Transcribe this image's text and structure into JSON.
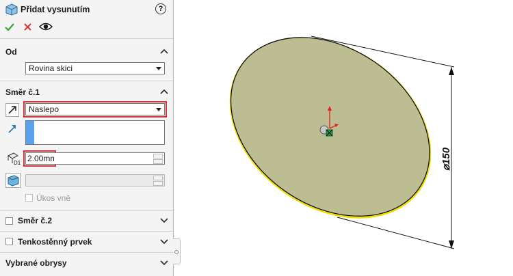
{
  "header": {
    "title": "Přidat vysunutím",
    "help": "?"
  },
  "sections": {
    "od": {
      "title": "Od",
      "select_value": "Rovina skici"
    },
    "smer1": {
      "title": "Směr č.1",
      "end_condition": "Naslepo",
      "depth": "2.00mm",
      "draft_label": "Úkos vně"
    },
    "smer2": {
      "title": "Směr č.2"
    },
    "thin": {
      "title": "Tenkostěnný prvek"
    },
    "contours": {
      "title": "Vybrané obrysy"
    }
  },
  "model": {
    "dimension_label": "⌀150",
    "face_color": "#bdbd93",
    "edge_color": "#f0e000"
  },
  "colors": {
    "accent_red": "#d9353a",
    "ok_green": "#3aa33a",
    "selection_blue": "#3a8ee6"
  },
  "icons": [
    "part-icon",
    "help-icon",
    "ok-check-icon",
    "cancel-x-icon",
    "preview-eye-icon",
    "reverse-direction-icon",
    "direction-vector-icon",
    "depth-icon",
    "draft-icon",
    "chevron-up-icon",
    "chevron-down-icon"
  ]
}
